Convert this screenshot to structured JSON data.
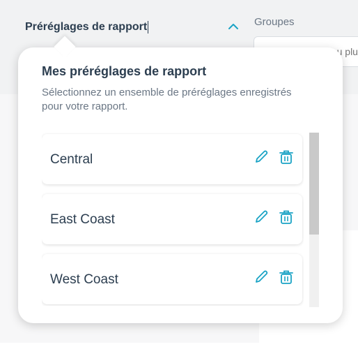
{
  "header": {
    "presets_label": "Préréglages de rapport",
    "groups_label": "Groupes",
    "groups_placeholder": "Choisissez une ou plusieurs zo..."
  },
  "popover": {
    "title": "Mes préréglages de rapport",
    "description": "Sélectionnez un ensemble de préréglages enregistrés pour votre rapport.",
    "items": [
      {
        "label": "Central",
        "icons": [
          "pencil-icon",
          "trash-icon"
        ]
      },
      {
        "label": "East Coast",
        "icons": [
          "pencil-icon",
          "trash-icon"
        ]
      },
      {
        "label": "West Coast",
        "icons": [
          "pencil-icon",
          "trash-icon"
        ]
      }
    ],
    "scrollbar_position": 0
  },
  "colors": {
    "accent": "#1aa3c5",
    "title_text": "#2c3e50",
    "muted_text": "#6b7785"
  }
}
